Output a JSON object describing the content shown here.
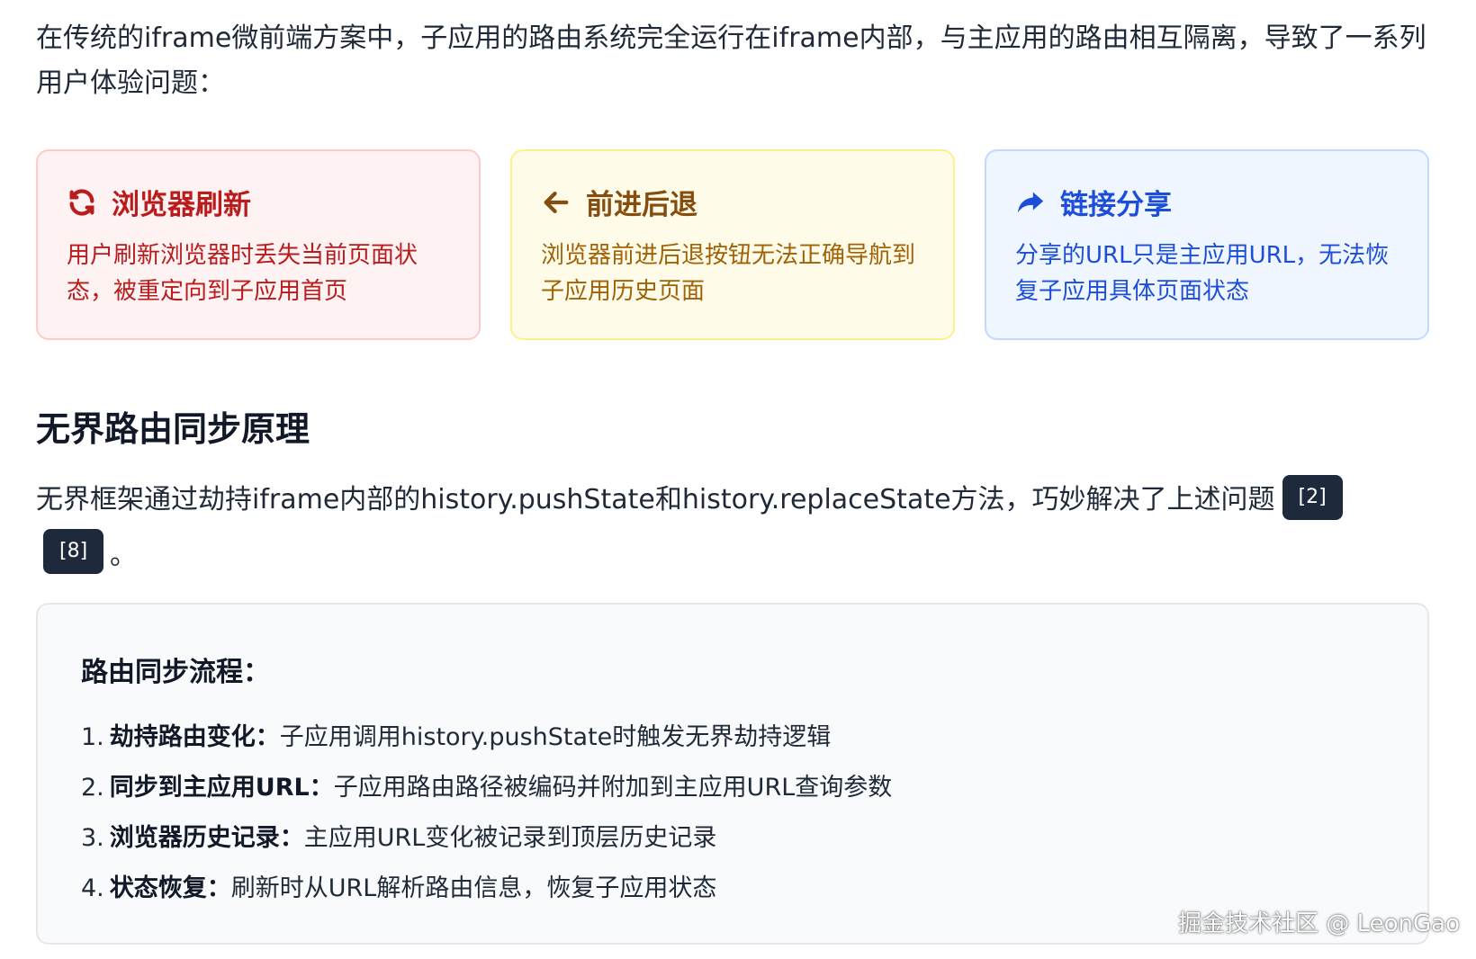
{
  "intro": "在传统的iframe微前端方案中，子应用的路由系统完全运行在iframe内部，与主应用的路由相互隔离，导致了一系列用户体验问题：",
  "cards": [
    {
      "icon": "refresh-icon",
      "title": "浏览器刷新",
      "body": "用户刷新浏览器时丢失当前页面状态，被重定向到子应用首页",
      "accent": "#b91c1c"
    },
    {
      "icon": "arrow-left-icon",
      "title": "前进后退",
      "body": "浏览器前进后退按钮无法正确导航到子应用历史页面",
      "accent": "#854d0e"
    },
    {
      "icon": "share-icon",
      "title": "链接分享",
      "body": "分享的URL只是主应用URL，无法恢复子应用具体页面状态",
      "accent": "#1d4ed8"
    }
  ],
  "section_title": "无界路由同步原理",
  "paragraph": "无界框架通过劫持iframe内部的history.pushState和history.replaceState方法，巧妙解决了上述问题",
  "citations": [
    "[2]",
    "[8]"
  ],
  "period": "。",
  "flow": {
    "title": "路由同步流程：",
    "steps": [
      {
        "num": "1.",
        "key": "劫持路由变化：",
        "text": "子应用调用history.pushState时触发无界劫持逻辑"
      },
      {
        "num": "2.",
        "key": "同步到主应用URL：",
        "text": "子应用路由路径被编码并附加到主应用URL查询参数"
      },
      {
        "num": "3.",
        "key": "浏览器历史记录：",
        "text": "主应用URL变化被记录到顶层历史记录"
      },
      {
        "num": "4.",
        "key": "状态恢复：",
        "text": "刷新时从URL解析路由信息，恢复子应用状态"
      }
    ]
  },
  "watermark": "掘金技术社区 @ LeonGao"
}
